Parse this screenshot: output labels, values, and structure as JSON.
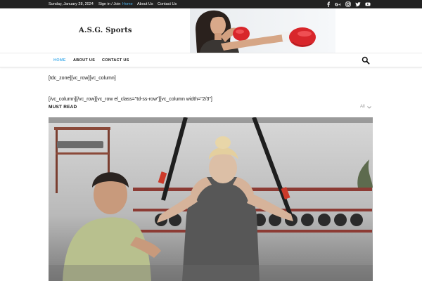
{
  "topbar": {
    "date": "Sunday, January 28, 2024",
    "links": [
      "Sign in / Join",
      "Home",
      "About Us",
      "Contact Us"
    ],
    "active_link": "Home",
    "social_icons": [
      "facebook-icon",
      "google-plus-icon",
      "instagram-icon",
      "twitter-icon",
      "youtube-icon"
    ]
  },
  "header": {
    "site_title": "A.S.G. Sports",
    "banner_subject": "boxer-with-red-gloves"
  },
  "nav": {
    "items": [
      "HOME",
      "ABOUT US",
      "CONTACT US"
    ],
    "active": "HOME",
    "search_icon": "search-icon"
  },
  "content": {
    "shortcode_1": "[tdc_zone][vc_row][vc_column]",
    "shortcode_2": "[/vc_column][/vc_row][vc_row el_class=\"td-ss-row\"][vc_column width=\"2/3\"]",
    "block_title": "MUST READ",
    "filter_label": "All",
    "feature_image": "trainer-and-woman-doing-suspension-training"
  },
  "colors": {
    "topbar_bg": "#222222",
    "accent": "#4db2ec",
    "glove_red": "#d8262b"
  }
}
